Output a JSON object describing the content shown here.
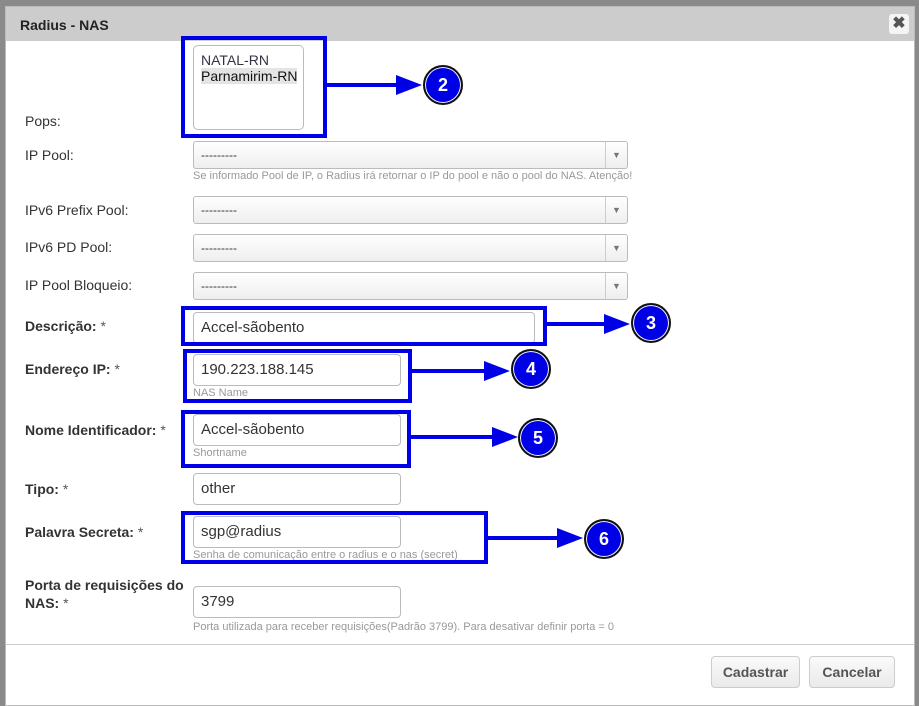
{
  "dialog": {
    "title": "Radius - NAS",
    "close_icon": "close-icon"
  },
  "form": {
    "pops": {
      "label": "Pops:",
      "options": [
        "NATAL-RN",
        "Parnamirim-RN"
      ]
    },
    "ip_pool": {
      "label": "IP Pool:",
      "value": "---------",
      "help": "Se informado Pool de IP, o Radius irá retornar o IP do pool e não o pool do NAS. Atenção!"
    },
    "ipv6_prefix_pool": {
      "label": "IPv6 Prefix Pool:",
      "value": "---------"
    },
    "ipv6_pd_pool": {
      "label": "IPv6 PD Pool:",
      "value": "---------"
    },
    "ip_pool_bloqueio": {
      "label": "IP Pool Bloqueio:",
      "value": "---------"
    },
    "descricao": {
      "label": "Descrição:",
      "value": "Accel-sãobento"
    },
    "endereco_ip": {
      "label": "Endereço IP:",
      "value": "190.223.188.145",
      "help": "NAS Name"
    },
    "nome_identificador": {
      "label": "Nome Identificador:",
      "value": "Accel-sãobento",
      "help": "Shortname"
    },
    "tipo": {
      "label": "Tipo:",
      "value": "other"
    },
    "palavra_secreta": {
      "label": "Palavra Secreta:",
      "value": "sgp@radius",
      "help": "Senha de comunicação entre o radius e o nas (secret)"
    },
    "porta": {
      "label_line1": "Porta de requisições do",
      "label_line2": "NAS:",
      "value": "3799",
      "help": "Porta utilizada para receber requisições(Padrão 3799). Para desativar definir porta = 0"
    },
    "required_mark": "*"
  },
  "footer": {
    "submit": "Cadastrar",
    "cancel": "Cancelar"
  },
  "annotations": [
    "2",
    "3",
    "4",
    "5",
    "6"
  ],
  "colors": {
    "annotation": "#0000e6",
    "header": "#cccccc"
  }
}
